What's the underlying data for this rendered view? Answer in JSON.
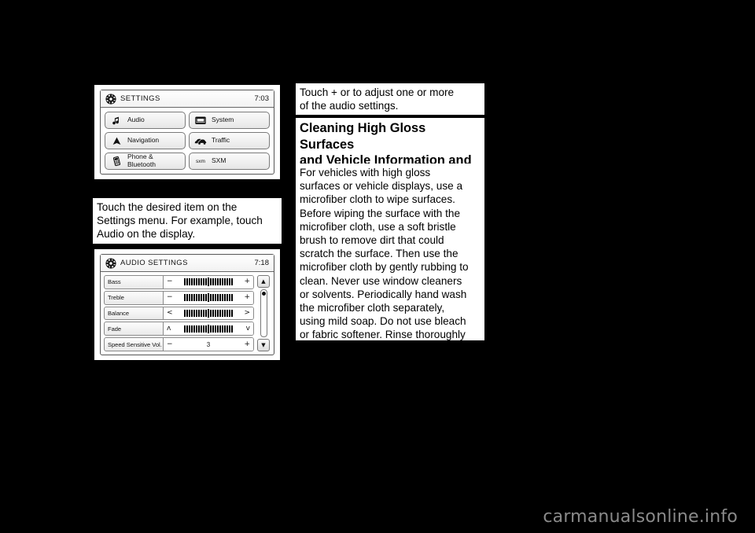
{
  "page": {
    "background_color": "#000000",
    "content_color": "#ffffff",
    "watermark": "carmanualsonline.info"
  },
  "figures": {
    "settings_screen": {
      "title": "SETTINGS",
      "clock": "7:03",
      "header_icon": "gear-icon",
      "menu_items": [
        {
          "label": "Audio",
          "icon": "music-note-icon"
        },
        {
          "label": "System",
          "icon": "display-screen-icon"
        },
        {
          "label": "Navigation",
          "icon": "navigation-arrow-icon"
        },
        {
          "label": "Traffic",
          "icon": "traffic-cars-icon"
        },
        {
          "label": "Phone &\nBluetooth",
          "icon": "mobile-phone-icon"
        },
        {
          "label": "SXM",
          "icon": "sxm-logo-icon",
          "mark": "sxm"
        }
      ]
    },
    "audio_settings_screen": {
      "title": "AUDIO SETTINGS",
      "clock": "7:18",
      "header_icon": "gear-icon",
      "rows": [
        {
          "label": "Bass",
          "left_symbol": "−",
          "right_symbol": "+",
          "control": "bargraph"
        },
        {
          "label": "Treble",
          "left_symbol": "−",
          "right_symbol": "+",
          "control": "bargraph"
        },
        {
          "label": "Balance",
          "left_symbol": "<",
          "right_symbol": ">",
          "control": "bargraph"
        },
        {
          "label": "Fade",
          "left_symbol": "ʌ",
          "right_symbol": "v",
          "control": "bargraph"
        },
        {
          "label": "Speed Sensitive Vol.",
          "left_symbol": "−",
          "right_symbol": "+",
          "control": "value",
          "value": "3"
        }
      ],
      "scrollbar": {
        "up_arrow": "▲",
        "down_arrow": "▼"
      }
    }
  },
  "body": {
    "touch_settings_paragraph": "Touch the desired item on the\nSettings menu. For example, touch\nAudio on the display.",
    "touch_adjust_paragraph": "Touch + or     to adjust one or more\nof the audio settings.",
    "cleaning_heading": "Cleaning High Gloss Surfaces\nand Vehicle Information and\nRadio Displays",
    "cleaning_paragraph": "For vehicles with high gloss\nsurfaces or vehicle displays, use a\nmicrofiber cloth to wipe surfaces.\nBefore wiping the surface with the\nmicrofiber cloth, use a soft bristle\nbrush to remove dirt that could\nscratch the surface. Then use the\nmicrofiber cloth by gently rubbing to\nclean. Never use window cleaners\nor solvents. Periodically hand wash\nthe microfiber cloth separately,\nusing mild soap. Do not use bleach\nor fabric softener. Rinse thoroughly\nand air dry before next use."
  }
}
